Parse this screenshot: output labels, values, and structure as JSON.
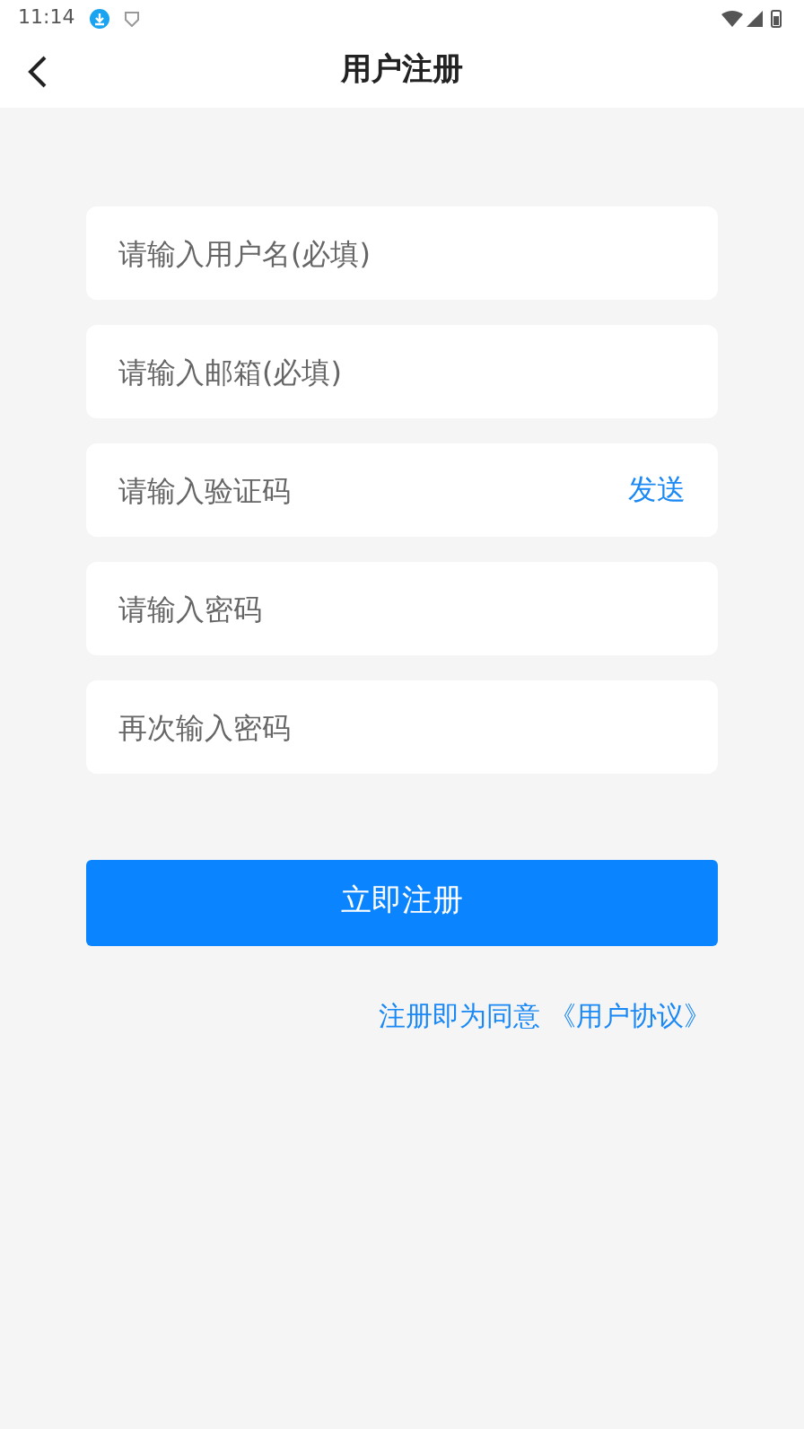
{
  "status_bar": {
    "time": "11:14"
  },
  "header": {
    "title": "用户注册"
  },
  "fields": [
    {
      "placeholder": "请输入用户名(必填)"
    },
    {
      "placeholder": "请输入邮箱(必填)"
    },
    {
      "placeholder": "请输入验证码",
      "action": "发送"
    },
    {
      "placeholder": "请输入密码"
    },
    {
      "placeholder": "再次输入密码"
    }
  ],
  "submit": "立即注册",
  "agreement": {
    "text": "注册即为同意",
    "link": "《用户协议》"
  }
}
